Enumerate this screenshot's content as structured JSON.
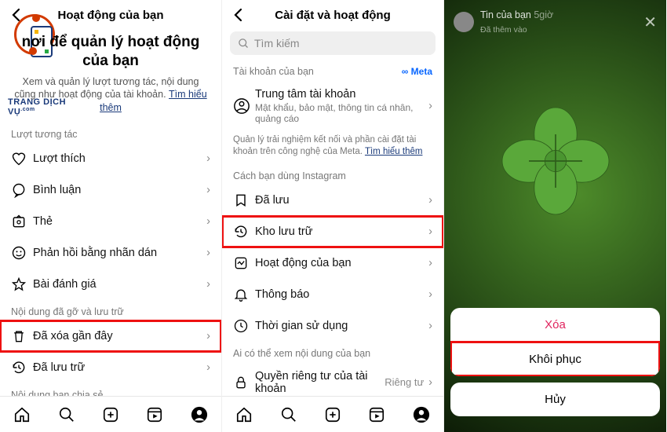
{
  "pane1": {
    "header_title": "Hoạt động của bạn",
    "watermark_text": "TRANG DỊCH VỤ",
    "watermark_suffix": ".com",
    "hero_icon_alt": "M",
    "hero_title": "nơi để quản lý hoạt động của bạn",
    "hero_desc": "Xem và quản lý lượt tương tác, nội dung cũng như hoạt động của tài khoản.",
    "hero_learn": "Tìm hiểu thêm",
    "section_interactions": "Lượt tương tác",
    "rows_interactions": [
      {
        "icon": "heart",
        "label": "Lượt thích"
      },
      {
        "icon": "chat",
        "label": "Bình luận"
      },
      {
        "icon": "tag",
        "label": "Thẻ"
      },
      {
        "icon": "sticker",
        "label": "Phản hồi bằng nhãn dán"
      },
      {
        "icon": "star",
        "label": "Bài đánh giá"
      }
    ],
    "section_removed": "Nội dung đã gỡ và lưu trữ",
    "rows_removed": [
      {
        "icon": "trash",
        "label": "Đã xóa gần đây",
        "hl": true
      },
      {
        "icon": "history",
        "label": "Đã lưu trữ"
      }
    ],
    "section_shared": "Nội dung bạn chia sẻ"
  },
  "pane2": {
    "header_title": "Cài đặt và hoạt động",
    "search_placeholder": "Tìm kiếm",
    "section_account": "Tài khoản của bạn",
    "meta_label": "Meta",
    "account_center": {
      "title": "Trung tâm tài khoản",
      "sub": "Mật khẩu, bảo mật, thông tin cá nhân, quảng cáo"
    },
    "blurb_text": "Quản lý trải nghiệm kết nối và phần cài đặt tài khoản trên công nghệ của Meta.",
    "blurb_link": "Tìm hiểu thêm",
    "section_usage": "Cách bạn dùng Instagram",
    "rows_usage": [
      {
        "icon": "bookmark",
        "label": "Đã lưu"
      },
      {
        "icon": "history",
        "label": "Kho lưu trữ",
        "hl": true
      },
      {
        "icon": "activity",
        "label": "Hoạt động của bạn"
      },
      {
        "icon": "bell",
        "label": "Thông báo"
      },
      {
        "icon": "clock",
        "label": "Thời gian sử dụng"
      }
    ],
    "section_visibility": "Ai có thể xem nội dung của bạn",
    "rows_visibility": [
      {
        "icon": "lock",
        "label": "Quyền riêng tư của tài khoản",
        "meta": "Riêng tư"
      }
    ]
  },
  "pane3": {
    "story_user": "Tin của bạn",
    "story_time": "5giờ",
    "story_sub": "Đã thêm vào",
    "sheet": {
      "delete": "Xóa",
      "restore": "Khôi phục",
      "cancel": "Hủy"
    }
  },
  "tabbar": [
    "home",
    "search",
    "create",
    "reels",
    "profile"
  ]
}
